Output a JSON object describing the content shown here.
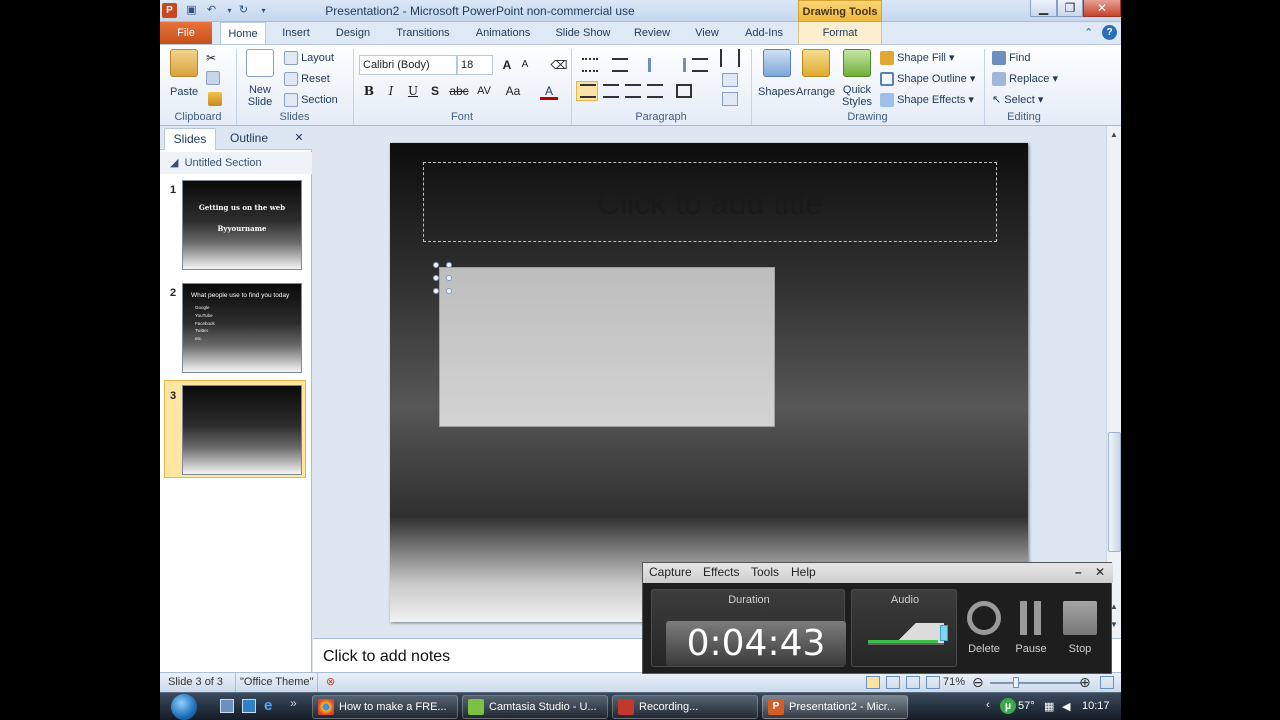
{
  "window": {
    "title": "Presentation2 - Microsoft PowerPoint non-commercial use",
    "context_tab": "Drawing Tools",
    "app_letter": "P",
    "controls": {
      "minimize": "▁",
      "restore": "❐",
      "close": "✕"
    }
  },
  "tabs": {
    "file": "File",
    "items": [
      "Home",
      "Insert",
      "Design",
      "Transitions",
      "Animations",
      "Slide Show",
      "Review",
      "View",
      "Add-Ins"
    ],
    "format": "Format",
    "active": "Home"
  },
  "ribbon": {
    "clipboard": {
      "label": "Clipboard",
      "paste": "Paste"
    },
    "slides": {
      "label": "Slides",
      "new_slide_1": "New",
      "new_slide_2": "Slide",
      "layout": "Layout",
      "reset": "Reset",
      "section": "Section"
    },
    "font": {
      "label": "Font",
      "family": "Calibri (Body)",
      "size": "18",
      "bold": "B",
      "italic": "I",
      "underline": "U",
      "shadow": "S",
      "strike": "abc",
      "spacing": "AV",
      "case": "Aa",
      "color": "A"
    },
    "paragraph": {
      "label": "Paragraph"
    },
    "drawing": {
      "label": "Drawing",
      "shapes": "Shapes",
      "arrange": "Arrange",
      "quick_1": "Quick",
      "quick_2": "Styles",
      "shape_fill": "Shape Fill",
      "shape_outline": "Shape Outline",
      "shape_effects": "Shape Effects"
    },
    "editing": {
      "label": "Editing",
      "find": "Find",
      "replace": "Replace",
      "select": "Select"
    }
  },
  "left_pane": {
    "tabs": [
      "Slides",
      "Outline"
    ],
    "close": "✕",
    "section": "Untitled Section",
    "slides": [
      {
        "num": "1",
        "title": "Getting us on the web",
        "subtitle": "Byyourname"
      },
      {
        "num": "2",
        "title": "What people use to find you today",
        "bullets": [
          "Google",
          "YouTube",
          "Facebook",
          "Twitter",
          "etc."
        ]
      },
      {
        "num": "3"
      }
    ]
  },
  "slide": {
    "title_placeholder": "Click to add title"
  },
  "notes": {
    "placeholder": "Click to add notes"
  },
  "status": {
    "slide": "Slide 3 of 3",
    "theme": "\"Office Theme\"",
    "zoom": "71%"
  },
  "camtasia": {
    "menu": [
      "Capture",
      "Effects",
      "Tools",
      "Help"
    ],
    "minimize": "–",
    "close": "✕",
    "duration_label": "Duration",
    "duration": "0:04:43",
    "audio_label": "Audio",
    "audio_level": 0.92,
    "delete": "Delete",
    "pause": "Pause",
    "stop": "Stop"
  },
  "taskbar": {
    "items": [
      "How to make a FRE...",
      "Camtasia Studio - U...",
      "Recording...",
      "Presentation2 - Micr..."
    ],
    "active": "Presentation2 - Micr...",
    "weather": "57°",
    "clock": "10:17"
  },
  "colors": {
    "file_tab": "#d35f27",
    "context_tab": "#f0b83b",
    "selected_thumb": "#fde6a1"
  }
}
